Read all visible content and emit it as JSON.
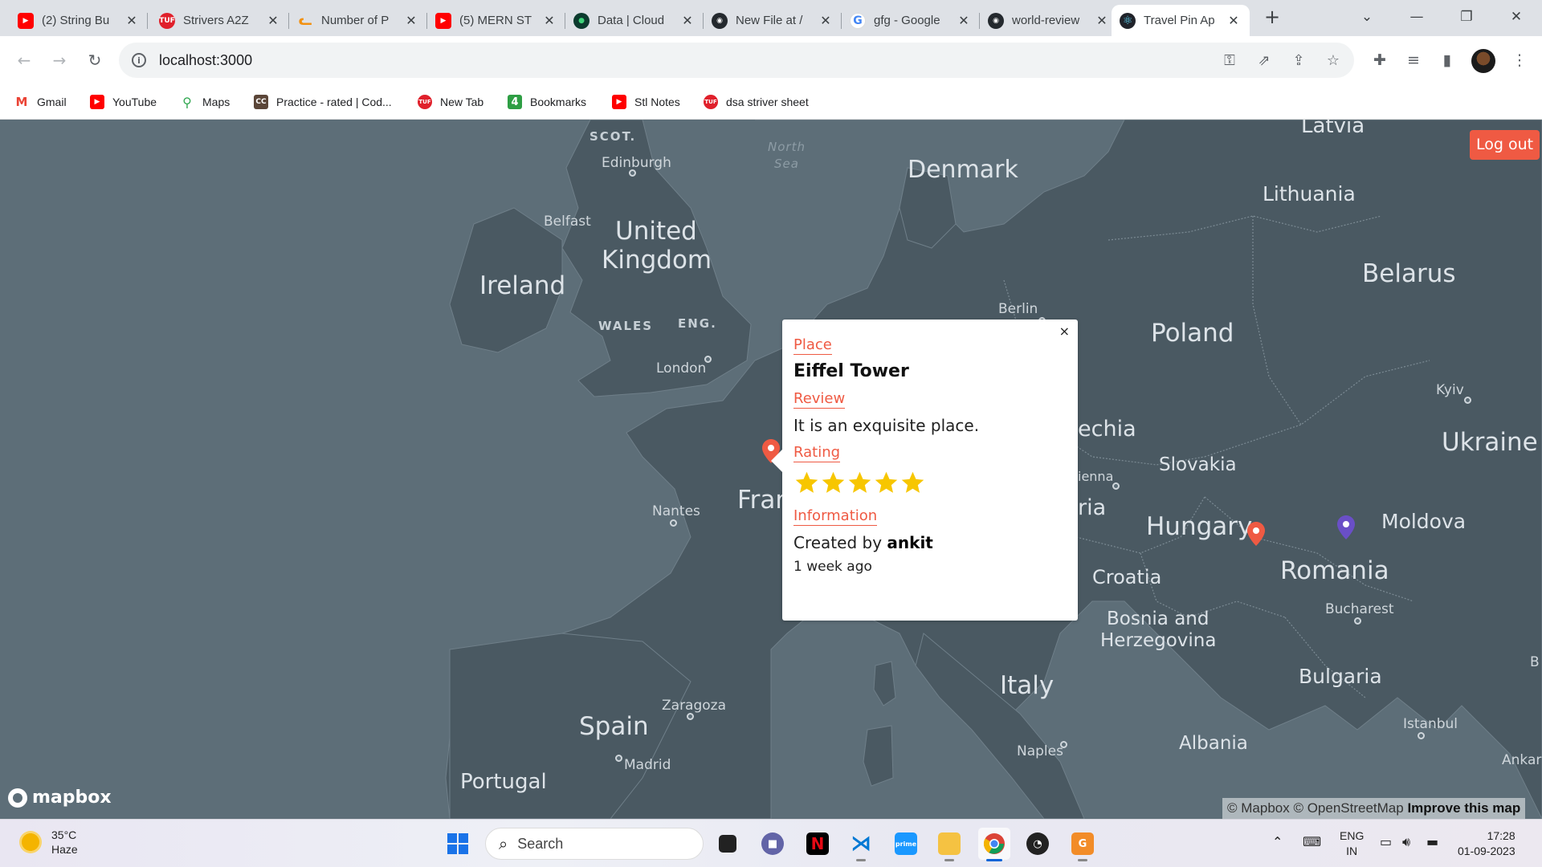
{
  "tabs": [
    {
      "title": "(2) String Bu",
      "icon": "youtube-icon",
      "color": "#ff0000"
    },
    {
      "title": "Strivers A2Z",
      "icon": "tuf-icon",
      "color": "#e0202b"
    },
    {
      "title": "Number of P",
      "icon": "codeforces-like-icon",
      "color": "#f29111"
    },
    {
      "title": "(5) MERN ST",
      "icon": "youtube-icon",
      "color": "#ff0000"
    },
    {
      "title": "Data | Cloud",
      "icon": "mongodb-icon",
      "color": "#0c7a3e"
    },
    {
      "title": "New File at /",
      "icon": "github-icon",
      "color": "#24292e"
    },
    {
      "title": "gfg - Google",
      "icon": "google-icon",
      "color": "#4285f4"
    },
    {
      "title": "world-review",
      "icon": "github-icon",
      "color": "#24292e"
    },
    {
      "title": "Travel Pin Ap",
      "icon": "react-icon",
      "color": "#61dafb"
    }
  ],
  "address": {
    "url": "localhost:3000"
  },
  "bookmarks": [
    {
      "label": "Gmail",
      "icon": "gmail-icon",
      "color": "#ea4335"
    },
    {
      "label": "YouTube",
      "icon": "youtube-icon",
      "color": "#ff0000"
    },
    {
      "label": "Maps",
      "icon": "maps-icon",
      "color": "#34a853"
    },
    {
      "label": "Practice - rated | Cod...",
      "icon": "codechef-icon",
      "color": "#5b4638"
    },
    {
      "label": "New Tab",
      "icon": "tuf-icon",
      "color": "#e0202b"
    },
    {
      "label": "Bookmarks",
      "icon": "four-icon",
      "color": "#2e9e44"
    },
    {
      "label": "Stl Notes",
      "icon": "youtube-icon",
      "color": "#ff0000"
    },
    {
      "label": "dsa striver sheet",
      "icon": "tuf-icon",
      "color": "#e0202b"
    }
  ],
  "map": {
    "logout_label": "Log out",
    "logo": "mapbox",
    "attribution": "© Mapbox © OpenStreetMap",
    "attribution_link": "Improve this map",
    "labels": {
      "latvia": "Latvia",
      "lithuania": "Lithuania",
      "belarus": "Belarus",
      "denmark": "Denmark",
      "uk1": "United",
      "uk2": "Kingdom",
      "ireland": "Ireland",
      "poland": "Poland",
      "ukraine": "Ukraine",
      "moldova": "Moldova",
      "hungary": "Hungary",
      "romania": "Romania",
      "slovakia": "Slovakia",
      "croatia": "Croatia",
      "bosnia1": "Bosnia and",
      "bosnia2": "Herzegovina",
      "italy": "Italy",
      "bulgaria": "Bulgaria",
      "albania": "Albania",
      "spain": "Spain",
      "portugal": "Portugal",
      "france_partial": "Fran",
      "czechia_partial": "echia",
      "austria_partial": "ria",
      "scot": "SCOT.",
      "wales": "WALES",
      "eng": "ENG.",
      "edinburgh": "Edinburgh",
      "belfast": "Belfast",
      "london": "London",
      "berlin": "Berlin",
      "kyiv": "Kyiv",
      "vienna_partial": "ienna",
      "nantes": "Nantes",
      "bucharest": "Bucharest",
      "zaragoza": "Zaragoza",
      "madrid": "Madrid",
      "naples": "Naples",
      "istanbul": "Istanbul",
      "ankara_partial": "Ankar",
      "greece_partial": "B",
      "sea1": "North",
      "sea2": "Sea"
    },
    "pin_colors": {
      "user": "#ef5a43",
      "other": "#6a4fc7"
    }
  },
  "popup": {
    "place_label": "Place",
    "place": "Eiffel Tower",
    "review_label": "Review",
    "review": "It is an exquisite place.",
    "rating_label": "Rating",
    "rating": 5,
    "rating_max": 5,
    "info_label": "Information",
    "created_prefix": "Created by",
    "author": "ankit",
    "time_ago": "1 week ago",
    "close_glyph": "×"
  },
  "taskbar": {
    "weather_temp": "35°C",
    "weather_desc": "Haze",
    "search_placeholder": "Search",
    "apps": [
      "windows-start-icon",
      "task-view-icon",
      "teams-chat-icon",
      "netflix-icon",
      "vscode-icon",
      "prime-video-icon",
      "file-explorer-icon",
      "chrome-icon",
      "obs-icon",
      "app-icon"
    ],
    "lang1": "ENG",
    "lang2": "IN",
    "time": "17:28",
    "date": "01-09-2023"
  }
}
